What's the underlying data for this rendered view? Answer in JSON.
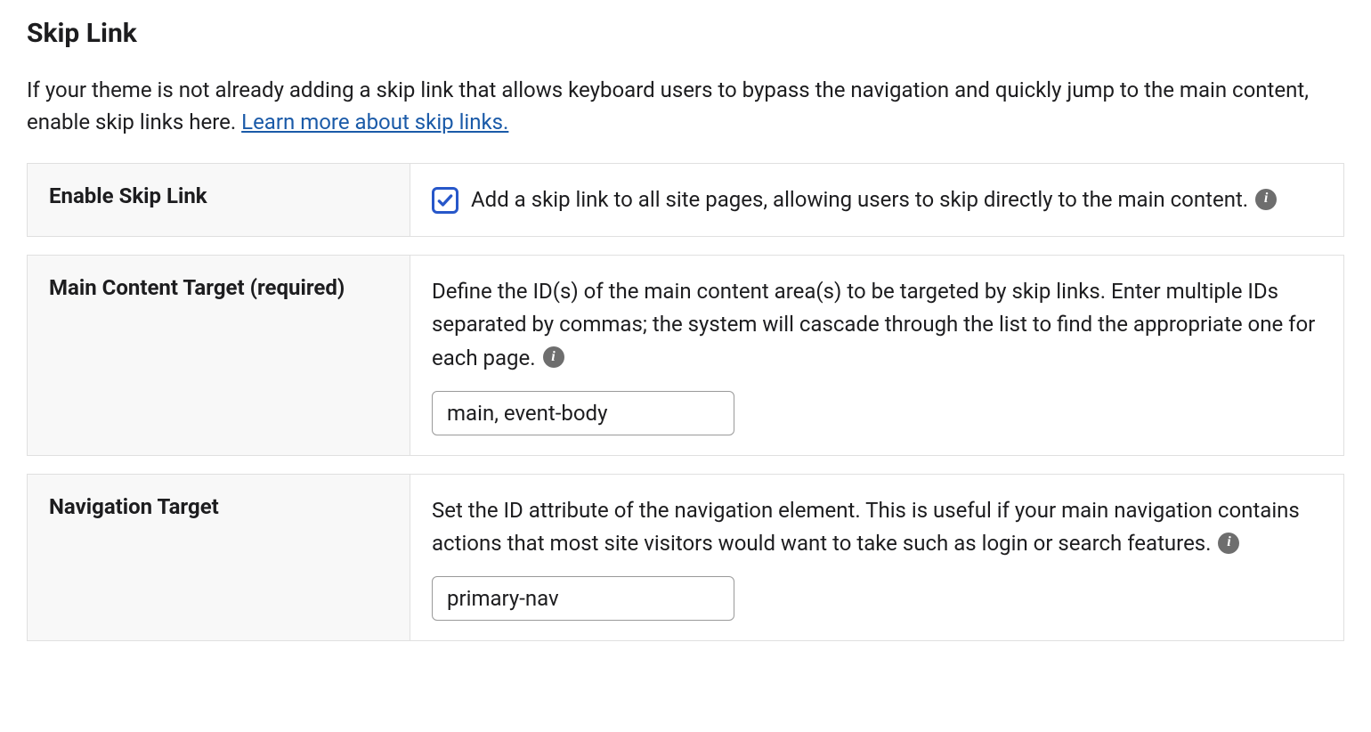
{
  "section": {
    "title": "Skip Link",
    "description_pre_link": "If your theme is not already adding a skip link that allows keyboard users to bypass the navigation and quickly jump to the main content, enable skip links here. ",
    "link_text": "Learn more about skip links."
  },
  "rows": {
    "enable": {
      "label": "Enable Skip Link",
      "checkbox_checked": true,
      "text": "Add a skip link to all site pages, allowing users to skip directly to the main content."
    },
    "main_target": {
      "label": "Main Content Target (required)",
      "description": "Define the ID(s) of the main content area(s) to be targeted by skip links. Enter multiple IDs separated by commas; the system will cascade through the list to find the appropriate one for each page.",
      "value": "main, event-body"
    },
    "nav_target": {
      "label": "Navigation Target",
      "description": "Set the ID attribute of the navigation element. This is useful if your main navigation contains actions that most site visitors would want to take such as login or search features.",
      "value": "primary-nav"
    }
  }
}
